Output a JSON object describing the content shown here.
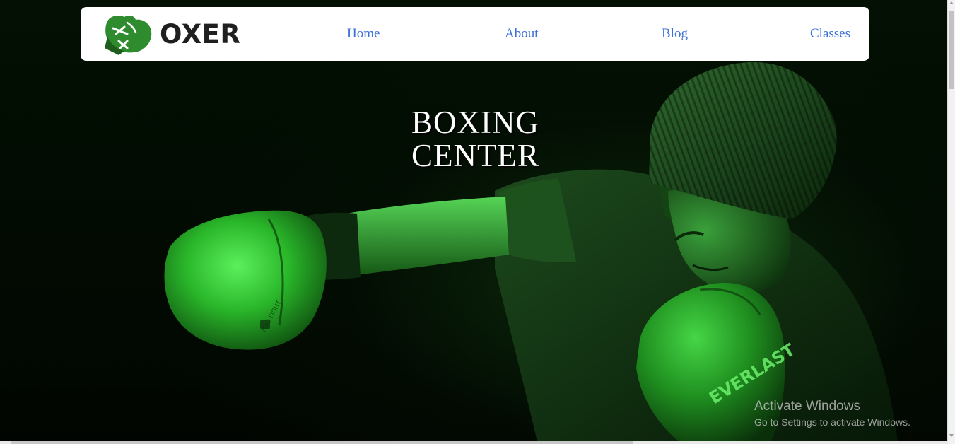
{
  "brand": {
    "name": "OXER",
    "glove_color": "#2e8b2e"
  },
  "nav": {
    "items": [
      {
        "label": "Home"
      },
      {
        "label": "About"
      },
      {
        "label": "Blog"
      },
      {
        "label": "Classes"
      }
    ],
    "link_color": "#3a6fd8"
  },
  "hero": {
    "title_line1": "BOXING",
    "title_line2": "CENTER",
    "image_subject": "boxer-punching-green-tint",
    "glove_brand_text": "EVERLAST",
    "glove_small_text": "PRO FIGHT",
    "accent": "#2fbf2f"
  },
  "os_watermark": {
    "title": "Activate Windows",
    "subtitle": "Go to Settings to activate Windows."
  }
}
